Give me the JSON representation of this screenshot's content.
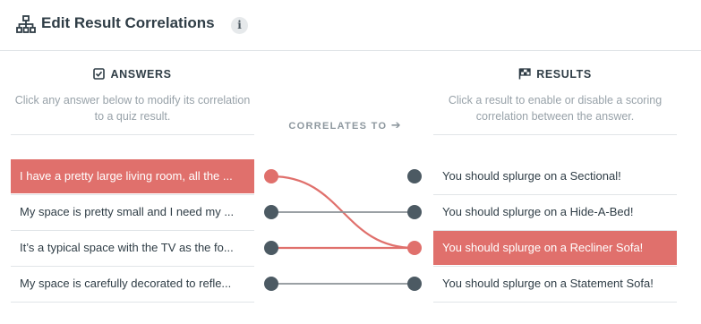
{
  "header": {
    "title": "Edit Result Correlations",
    "title_icon": "sitemap-icon",
    "info_glyph": "i"
  },
  "answers": {
    "heading": "ANSWERS",
    "heading_icon": "checkbox-icon",
    "description": "Click any answer below to modify its correlation to a quiz result.",
    "items": [
      {
        "label": "I have a pretty large living room, all the ...",
        "active": true
      },
      {
        "label": "My space is pretty small and I need my ...",
        "active": false
      },
      {
        "label": "It’s a typical space with the TV as the fo...",
        "active": false
      },
      {
        "label": "My space is carefully decorated to refle...",
        "active": false
      }
    ]
  },
  "middle": {
    "label": "CORRELATES TO",
    "arrow": "➔"
  },
  "results": {
    "heading": "RESULTS",
    "heading_icon": "checkered-flag-icon",
    "description": "Click a result to enable or disable a scoring correlation between the answer.",
    "items": [
      {
        "label": "You should splurge on a Sectional!",
        "active": false
      },
      {
        "label": "You should splurge on a Hide-A-Bed!",
        "active": false
      },
      {
        "label": "You should splurge on a Recliner Sofa!",
        "active": true
      },
      {
        "label": "You should splurge on a Statement Sofa!",
        "active": false
      }
    ]
  },
  "correlations": [
    {
      "answer": 0,
      "result": 2,
      "highlighted": true
    },
    {
      "answer": 1,
      "result": 1,
      "highlighted": false
    },
    {
      "answer": 2,
      "result": 2,
      "highlighted": true
    },
    {
      "answer": 3,
      "result": 3,
      "highlighted": false
    }
  ],
  "colors": {
    "accent": "#e0706c",
    "node": "#4c5a63",
    "line": "#8c9397",
    "text": "#2f3d46",
    "muted": "#98a2a9"
  }
}
